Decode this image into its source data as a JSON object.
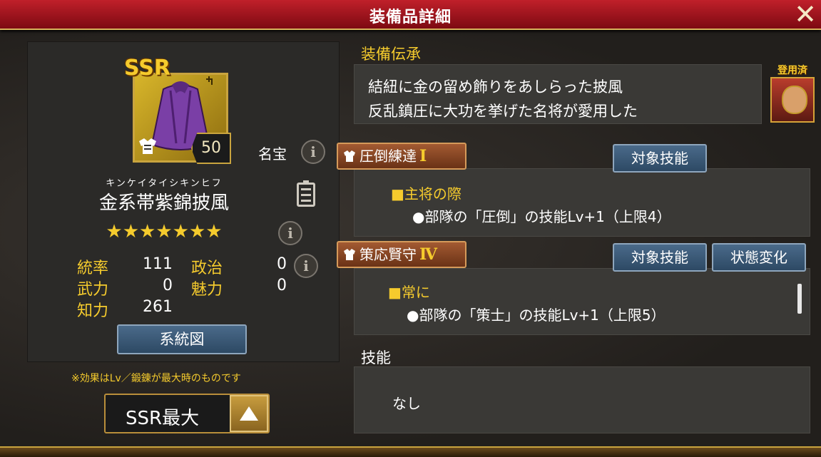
{
  "window": {
    "title": "装備品詳細"
  },
  "item": {
    "rarity": "SSR",
    "level": "50",
    "tag": "名宝",
    "kana": "キンケイタイシキンヒフ",
    "name": "金系帯紫錦披風",
    "stars": "★★★★★★★",
    "stats": [
      {
        "label": "統率",
        "value": "111"
      },
      {
        "label": "政治",
        "value": "0"
      },
      {
        "label": "武力",
        "value": "0"
      },
      {
        "label": "魅力",
        "value": "0"
      },
      {
        "label": "知力",
        "value": "261"
      }
    ],
    "lineage_button": "系統図",
    "note": "※効果はLv／鍛錬が最大時のものです",
    "level_select": "SSR最大"
  },
  "inheritance": {
    "heading": "装備伝承",
    "lines": [
      "結紐に金の留め飾りをあしらった披風",
      "反乱鎮圧に大功を挙げた名将が愛用した"
    ],
    "equipped_label": "登用済"
  },
  "skills": [
    {
      "name": "圧倒練達",
      "grade": "Ⅰ",
      "buttons": [
        "対象技能"
      ],
      "condition": "■主将の際",
      "effect": "●部隊の「圧倒」の技能Lv+1（上限4）"
    },
    {
      "name": "策応賢守",
      "grade": "Ⅳ",
      "buttons": [
        "対象技能",
        "状態変化"
      ],
      "condition": "■常に",
      "effect": "●部隊の「策士」の技能Lv+1（上限5）"
    }
  ],
  "ability": {
    "heading": "技能",
    "value": "なし"
  },
  "icons": {
    "close": "close-icon",
    "info": "info-icon",
    "clipboard": "clipboard-icon",
    "armor": "armor-icon",
    "up": "arrow-up-icon"
  },
  "colors": {
    "accent_gold": "#f5cb2d",
    "title_red": "#b01c24",
    "button_blue": "#3a5a7a"
  }
}
